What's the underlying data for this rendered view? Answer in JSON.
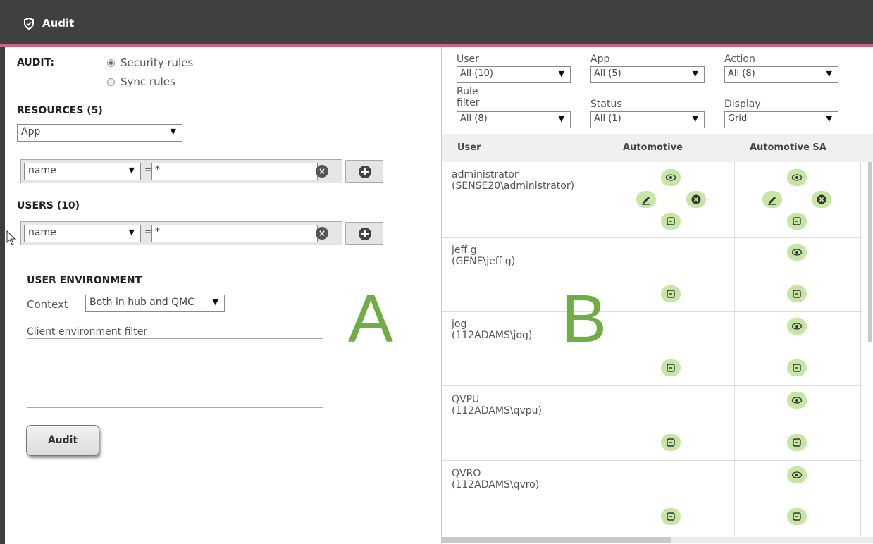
{
  "header": {
    "title": "Audit"
  },
  "left": {
    "audit_label": "AUDIT:",
    "radio_security": "Security rules",
    "radio_sync": "Sync rules",
    "resources_label": "RESOURCES (5)",
    "resource_type": "App",
    "resource_filter": {
      "field": "name",
      "op": "=",
      "value": "*"
    },
    "users_label": "USERS (10)",
    "user_filter": {
      "field": "name",
      "op": "=",
      "value": "*"
    },
    "user_env_label": "USER ENVIRONMENT",
    "context_label": "Context",
    "context_value": "Both in hub and QMC",
    "client_env_label": "Client environment filter",
    "audit_button": "Audit",
    "big_letter": "A"
  },
  "right": {
    "filters": {
      "user": {
        "label": "User",
        "value": "All (10)"
      },
      "app": {
        "label": "App",
        "value": "All (5)"
      },
      "action": {
        "label": "Action",
        "value": "All (8)"
      },
      "rule_filter": {
        "label1": "Rule",
        "label2": "filter",
        "value": "All (8)"
      },
      "status": {
        "label": "Status",
        "value": "All (1)"
      },
      "display": {
        "label": "Display",
        "value": "Grid"
      }
    },
    "columns": [
      "User",
      "Automotive",
      "Automotive SA"
    ],
    "rows": [
      {
        "name": "administrator",
        "account": "(SENSE20\\administrator)"
      },
      {
        "name": "jeff g",
        "account": "(GENE\\jeff g)"
      },
      {
        "name": "jog",
        "account": "(112ADAMS\\jog)"
      },
      {
        "name": "QVPU",
        "account": "(112ADAMS\\qvpu)"
      },
      {
        "name": "QVRO",
        "account": "(112ADAMS\\qvro)"
      }
    ],
    "big_letter": "B"
  },
  "colors": {
    "header_bg": "#404040",
    "accent_line": "#c9647f",
    "chip": "#c6e6a6",
    "letter": "#70ad47"
  }
}
